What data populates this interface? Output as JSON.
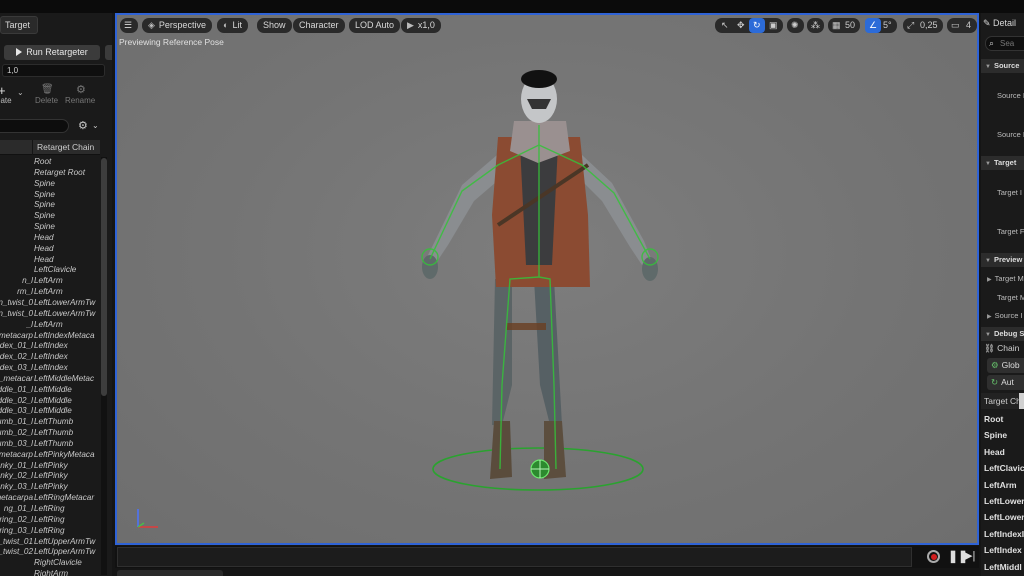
{
  "left_panel": {
    "tab_label": "Target",
    "run_button": "Run Retargeter",
    "value_field": "1,0",
    "toolbar": {
      "create": "eate",
      "delete": "Delete",
      "rename": "Rename"
    },
    "column_header": "Retarget Chain",
    "rows": [
      {
        "bone": "",
        "chain": "Root"
      },
      {
        "bone": "",
        "chain": "Retarget Root"
      },
      {
        "bone": "",
        "chain": "Spine"
      },
      {
        "bone": "",
        "chain": "Spine"
      },
      {
        "bone": "",
        "chain": "Spine"
      },
      {
        "bone": "",
        "chain": "Spine"
      },
      {
        "bone": "",
        "chain": "Spine"
      },
      {
        "bone": "",
        "chain": "Head"
      },
      {
        "bone": "",
        "chain": "Head"
      },
      {
        "bone": "",
        "chain": "Head"
      },
      {
        "bone": "",
        "chain": "LeftClavicle"
      },
      {
        "bone": "n_l",
        "chain": "LeftArm"
      },
      {
        "bone": "rm_l",
        "chain": "LeftArm"
      },
      {
        "bone": "n_twist_0",
        "chain": "LeftLowerArmTw"
      },
      {
        "bone": "n_twist_0",
        "chain": "LeftLowerArmTw"
      },
      {
        "bone": "_l",
        "chain": "LeftArm"
      },
      {
        "bone": "metacarp",
        "chain": "LeftIndexMetaca"
      },
      {
        "bone": "dex_01_l",
        "chain": "LeftIndex"
      },
      {
        "bone": "dex_02_l",
        "chain": "LeftIndex"
      },
      {
        "bone": "dex_03_l",
        "chain": "LeftIndex"
      },
      {
        "bone": "_metacar",
        "chain": "LeftMiddleMetac"
      },
      {
        "bone": "iddle_01_l",
        "chain": "LeftMiddle"
      },
      {
        "bone": "iddle_02_l",
        "chain": "LeftMiddle"
      },
      {
        "bone": "iddle_03_l",
        "chain": "LeftMiddle"
      },
      {
        "bone": "umb_01_l",
        "chain": "LeftThumb"
      },
      {
        "bone": "umb_02_l",
        "chain": "LeftThumb"
      },
      {
        "bone": "umb_03_l",
        "chain": "LeftThumb"
      },
      {
        "bone": "metacarp",
        "chain": "LeftPinkyMetaca"
      },
      {
        "bone": "nky_01_l",
        "chain": "LeftPinky"
      },
      {
        "bone": "nky_02_l",
        "chain": "LeftPinky"
      },
      {
        "bone": "nky_03_l",
        "chain": "LeftPinky"
      },
      {
        "bone": "metacarpa",
        "chain": "LeftRingMetacar"
      },
      {
        "bone": "ng_01_l",
        "chain": "LeftRing"
      },
      {
        "bone": "ring_02_l",
        "chain": "LeftRing"
      },
      {
        "bone": "ring_03_l",
        "chain": "LeftRing"
      },
      {
        "bone": "_twist_01",
        "chain": "LeftUpperArmTw"
      },
      {
        "bone": "_twist_02",
        "chain": "LeftUpperArmTw"
      },
      {
        "bone": "",
        "chain": "RightClavicle"
      },
      {
        "bone": "",
        "chain": "RightArm"
      }
    ]
  },
  "viewport": {
    "buttons": {
      "perspective": "Perspective",
      "lit": "Lit",
      "show": "Show",
      "character": "Character",
      "lod": "LOD Auto",
      "speed": "x1,0"
    },
    "grid_snap": "50",
    "angle_snap": "5°",
    "scale_snap": "0,25",
    "camera_speed": "4",
    "status_text": "Previewing Reference Pose"
  },
  "right_panel": {
    "tab_label": "Detail",
    "search_placeholder": "Sea",
    "sections": {
      "source": "Source",
      "target": "Target",
      "preview": "Preview",
      "debug": "Debug S"
    },
    "labels": {
      "source_1": "Source I",
      "source_2": "Source I",
      "target_1": "Target I",
      "target_2": "Target F",
      "preview_1": "Target M",
      "preview_2": "Target M",
      "preview_3": "Source I"
    },
    "chain_label": "Chain",
    "global_button": "Glob",
    "auto_button": "Aut",
    "target_chain_header": "Target Cha",
    "chains": [
      "Root",
      "Spine",
      "Head",
      "LeftClavic",
      "LeftArm",
      "LeftLower",
      "LeftLower",
      "LeftIndexI",
      "LeftIndex",
      "LeftMiddl"
    ]
  },
  "colors": {
    "viewport_border": "#2f63d6",
    "active_toggle": "#2c6bd8",
    "record": "#d21e1e",
    "ik_green": "#35c23a"
  }
}
